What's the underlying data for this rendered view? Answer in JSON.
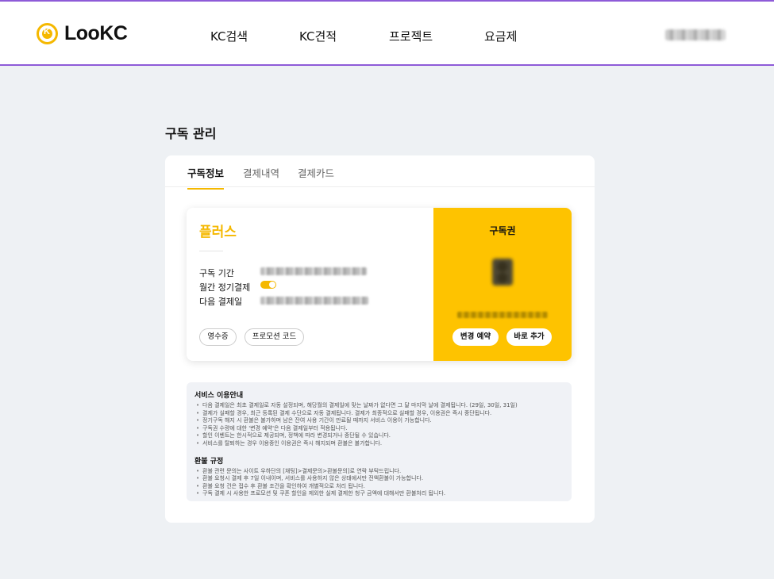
{
  "header": {
    "logo_text": "LooKC",
    "nav": [
      "KC검색",
      "KC견적",
      "프로젝트",
      "요금제"
    ],
    "user_name": "[blurred]"
  },
  "page": {
    "title": "구독 관리"
  },
  "tabs": [
    {
      "label": "구독정보",
      "active": true
    },
    {
      "label": "결제내역",
      "active": false
    },
    {
      "label": "결제카드",
      "active": false
    }
  ],
  "subscription": {
    "plan_name": "플러스",
    "period_label": "구독 기간",
    "monthly_label": "월간 정기결제",
    "monthly_enabled": true,
    "next_payment_label": "다음 결제일",
    "receipt_button": "영수증",
    "promo_button": "프로모션 코드"
  },
  "ticket": {
    "title": "구독권",
    "count": "3",
    "change_button": "변경 예약",
    "add_button": "바로 추가"
  },
  "notice": {
    "service_title": "서비스 이용안내",
    "service_items": [
      "다음 결제일은 최초 결제일로 자동 설정되며, 해당월의 결제일에 맞는 날짜가 없다면 그 달 마지막 날에 결제됩니다. (29일, 30일, 31일)",
      "결제가 실패할 경우, 최근 등록된 결제 수단으로 자동 결제됩니다. 결제가 최종적으로 실패할 경우, 이용권은 즉시 중단됩니다.",
      "정기구독 해지 시 환불은 불가하며 남은 잔여 사용 기간이 만료될 때까지 서비스 이용이 가능합니다.",
      "구독권 수량에 대한 '변경 예약'은 다음 결제일부터 적용됩니다.",
      "할인 이벤트는 한시적으로 제공되며, 정책에 따라 변경되거나 중단될 수 있습니다.",
      "서비스를 탈퇴하는 경우 이용중인 이용권은 즉시 해지되며 환불은 불가합니다."
    ],
    "refund_title": "환불 규정",
    "refund_items": [
      "환불 관련 문의는 사이트 우하단의 [채팅]>결제문의>환불문의]로 연락 부탁드립니다.",
      "환불 요청시 결제 후 7일 이내이며, 서비스를 사용하지 않은 상태에서만 전액환불이 가능합니다.",
      "환불 요청 건은 접수 후 환불 조건을 확인하여 개별적으로 처리 됩니다.",
      "구독 결제 시 사용한 프로모션 및 쿠폰 할인을 제외한 실제 결제한 청구 금액에 대해서만 환불처리 됩니다."
    ]
  },
  "colors": {
    "accent": "#fec300",
    "header_border": "#8e5bd8",
    "background": "#eef1f4"
  }
}
